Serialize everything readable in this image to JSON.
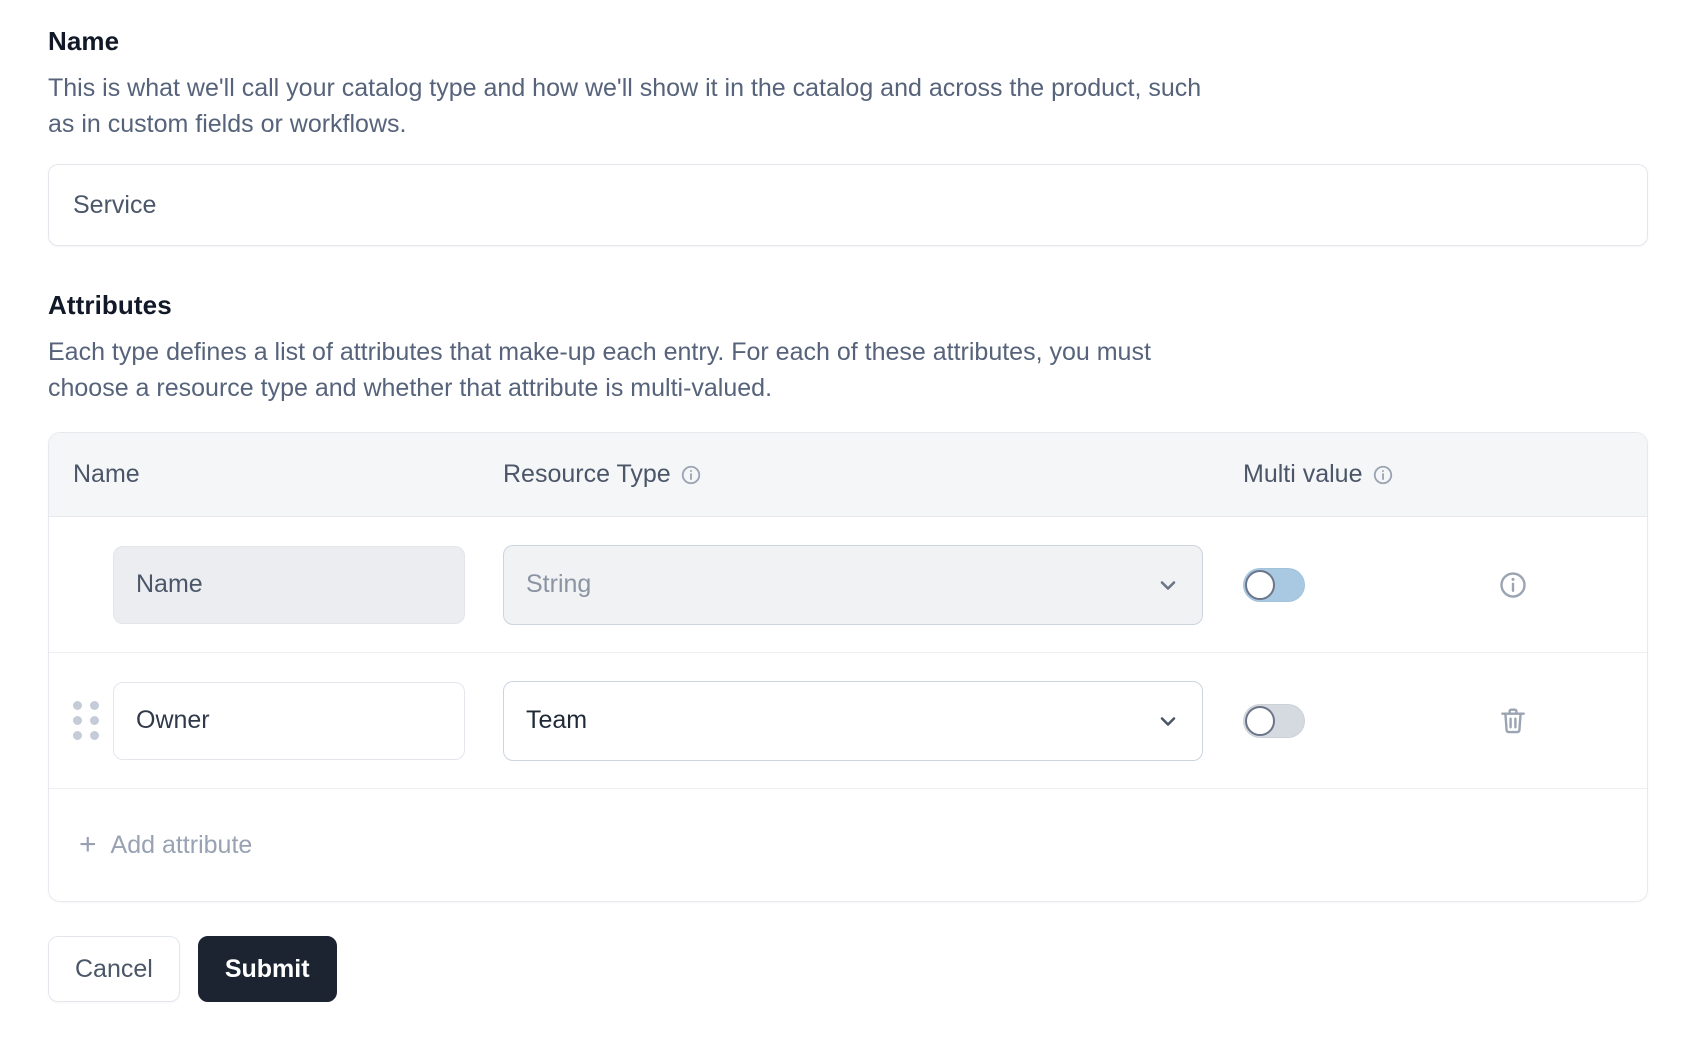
{
  "name_section": {
    "label": "Name",
    "description": "This is what we'll call your catalog type and how we'll show it in the catalog and across the product, such as in custom fields or workflows.",
    "input_value": "Service",
    "input_placeholder": "Service"
  },
  "attributes_section": {
    "label": "Attributes",
    "description": "Each type defines a list of attributes that make-up each entry. For each of these attributes, you must choose a resource type and whether that attribute is multi-valued.",
    "columns": {
      "name": "Name",
      "resource_type": "Resource Type",
      "multi_value": "Multi value"
    },
    "column_icons": {
      "resource_type": "info-icon",
      "multi_value": "info-icon"
    },
    "rows": [
      {
        "name": "Name",
        "resource_type": "String",
        "multi_value": false,
        "multi_value_state": "off-accent",
        "disabled": true,
        "draggable": false,
        "action_icon": "info-icon"
      },
      {
        "name": "Owner",
        "resource_type": "Team",
        "multi_value": false,
        "multi_value_state": "off",
        "disabled": false,
        "draggable": true,
        "action_icon": "trash-icon"
      }
    ],
    "add_attribute_label": "Add attribute",
    "add_attribute_icon": "plus-icon"
  },
  "footer": {
    "cancel_label": "Cancel",
    "submit_label": "Submit"
  },
  "colors": {
    "submit_bg": "#1c2331",
    "toggle_accent": "#a9c9e3",
    "toggle_off": "#d5d9e0",
    "muted_text": "#98a2b3",
    "body_text": "#56637a",
    "heading_text": "#111827"
  }
}
